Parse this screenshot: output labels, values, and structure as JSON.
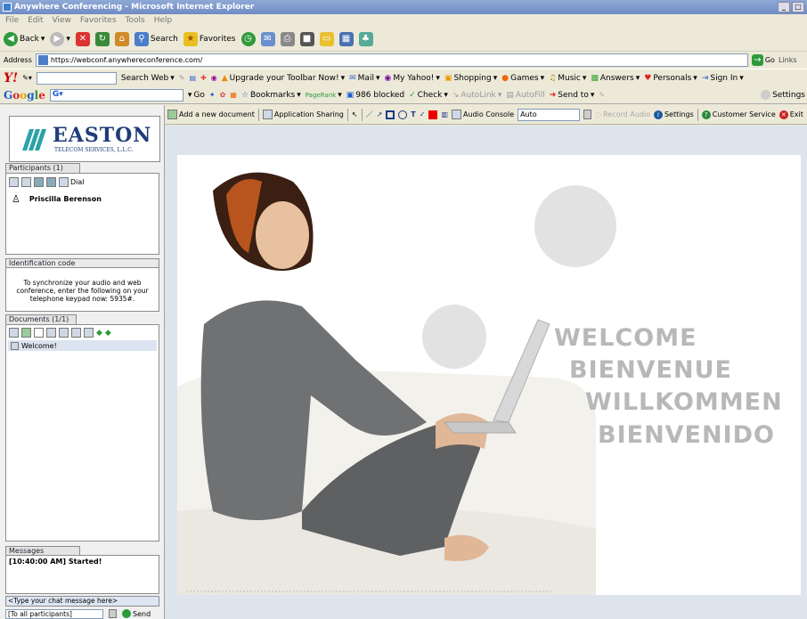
{
  "window": {
    "title": "Anywhere Conferencing - Microsoft Internet Explorer"
  },
  "menu": [
    "File",
    "Edit",
    "View",
    "Favorites",
    "Tools",
    "Help"
  ],
  "std_toolbar": {
    "back": "Back",
    "search": "Search",
    "favorites": "Favorites"
  },
  "address": {
    "label": "Address",
    "url": "https://webconf.anywhereconference.com/",
    "go": "Go",
    "links": "Links"
  },
  "yahoo_toolbar": {
    "logo": "Y!",
    "search_web": "Search Web",
    "upgrade": "Upgrade your Toolbar Now!",
    "mail": "Mail",
    "my_yahoo": "My Yahoo!",
    "shopping": "Shopping",
    "games": "Games",
    "music": "Music",
    "answers": "Answers",
    "personals": "Personals",
    "sign_in": "Sign In"
  },
  "google_toolbar": {
    "logo": "Google",
    "go": "Go",
    "bookmarks": "Bookmarks",
    "pagerank": "PageRank",
    "blocked": "986 blocked",
    "check": "Check",
    "autolink": "AutoLink",
    "autofill": "AutoFill",
    "send_to": "Send to",
    "settings": "Settings"
  },
  "logo": {
    "name": "EASTON",
    "sub": "TELECOM SERVICES, L.L.C."
  },
  "participants": {
    "title": "Participants (1)",
    "dial": "Dial",
    "list": [
      "Priscilla Berenson"
    ]
  },
  "identification": {
    "title": "Identification code",
    "text": "To synchronize your audio and web conference, enter the following on your telephone keypad now: 5935#."
  },
  "documents": {
    "title": "Documents (1/1)",
    "items": [
      "Welcome!"
    ]
  },
  "messages": {
    "title": "Messages",
    "log": [
      "[10:40:00 AM] Started!"
    ]
  },
  "chat": {
    "placeholder": "<Type your chat message here>",
    "recipient": "[To all participants]",
    "send": "Send"
  },
  "conf_toolbar": {
    "add_doc": "Add a new document",
    "app_sharing": "Application Sharing",
    "audio_console": "Audio Console",
    "audio_select": "Auto",
    "record_audio": "Record Audio",
    "settings": "Settings",
    "customer_service": "Customer Service",
    "exit": "Exit"
  },
  "welcome": {
    "lines": [
      "WELCOME",
      "BIENVENUE",
      "WILLKOMMEN",
      "BIENVENIDO"
    ]
  },
  "colors": {
    "accent": "#1a5aa0",
    "logo_teal": "#2aa3a8"
  }
}
